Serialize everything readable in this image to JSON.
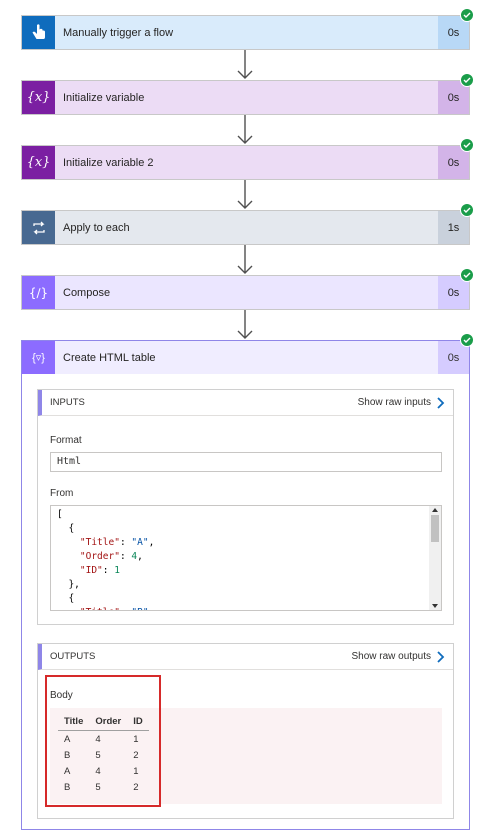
{
  "steps": [
    {
      "title": "Manually trigger a flow",
      "duration": "0s",
      "color": "#0f6cbd",
      "bg": "#d9ebfb",
      "durbg": "#b8d8f6"
    },
    {
      "title": "Initialize variable",
      "duration": "0s",
      "color": "#7b1fa2",
      "bg": "#ecdcf5",
      "durbg": "#d3b4e8"
    },
    {
      "title": "Initialize variable 2",
      "duration": "0s",
      "color": "#7b1fa2",
      "bg": "#ecdcf5",
      "durbg": "#d3b4e8"
    },
    {
      "title": "Apply to each",
      "duration": "1s",
      "color": "#486991",
      "bg": "#e4e8ee",
      "durbg": "#c9d1dc"
    },
    {
      "title": "Compose",
      "duration": "0s",
      "color": "#8c6cff",
      "bg": "#ebe6ff",
      "durbg": "#d5ccff"
    }
  ],
  "expanded": {
    "title": "Create HTML table",
    "duration": "0s",
    "inputs": {
      "header": "INPUTS",
      "link": "Show raw inputs",
      "format_label": "Format",
      "format_value": "Html",
      "from_label": "From",
      "from_lines": [
        "[",
        "  {",
        "    \"Title\": \"A\",",
        "    \"Order\": 4,",
        "    \"ID\": 1",
        "  },",
        "  {",
        "    \"Title\": \"B\","
      ]
    },
    "outputs": {
      "header": "OUTPUTS",
      "link": "Show raw outputs",
      "body_label": "Body",
      "columns": [
        "Title",
        "Order",
        "ID"
      ],
      "rows": [
        [
          "A",
          "4",
          "1"
        ],
        [
          "B",
          "5",
          "2"
        ],
        [
          "A",
          "4",
          "1"
        ],
        [
          "B",
          "5",
          "2"
        ]
      ]
    }
  }
}
